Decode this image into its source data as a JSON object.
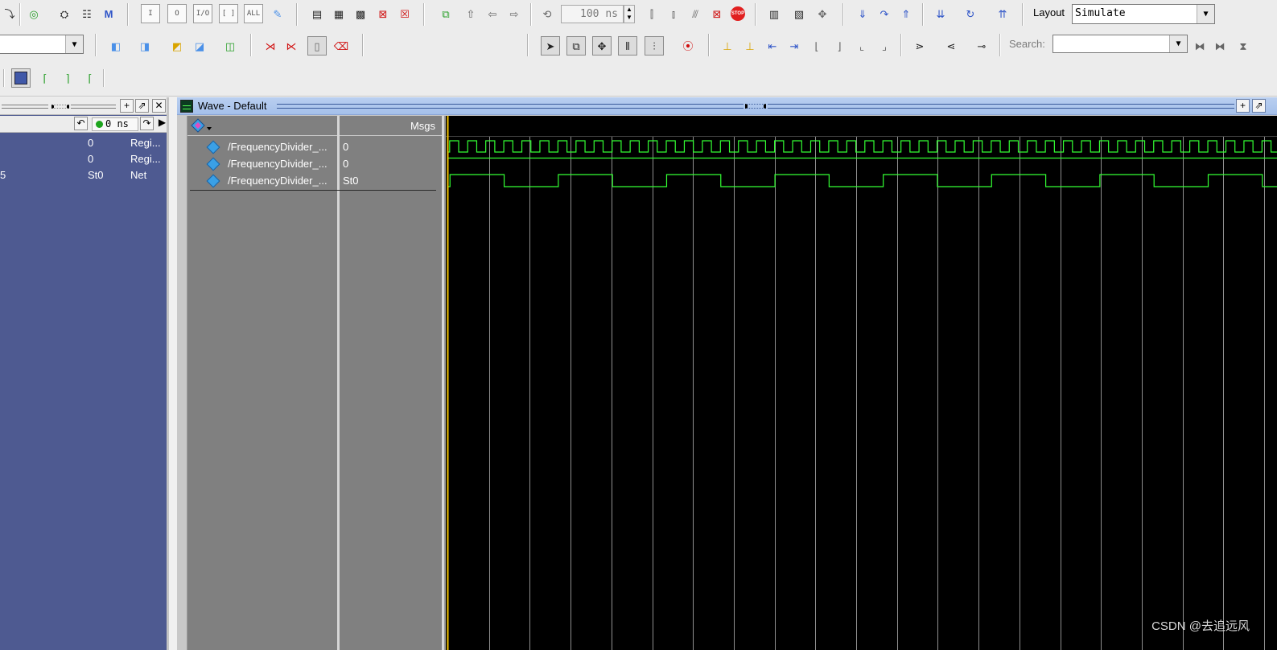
{
  "toolbar": {
    "row1_icons": [
      "step-icon",
      "sim-icon",
      "find-icon",
      "hierarchy-icon",
      "modelsim-icon"
    ],
    "radix_buttons": [
      "I",
      "O",
      "I/O",
      "[ ]",
      "ALL"
    ],
    "run_length": "100 ns",
    "layout_label": "Layout",
    "layout_value": "Simulate"
  },
  "search": {
    "label": "Search:",
    "value": ""
  },
  "objects": {
    "now_time": "0 ns",
    "rows": [
      {
        "value": "0",
        "kind": "Regi..."
      },
      {
        "value": "0",
        "kind": "Regi..."
      },
      {
        "prefix": "5",
        "value": "St0",
        "kind": "Net"
      }
    ]
  },
  "wave": {
    "title": "Wave - Default",
    "msgs_label": "Msgs",
    "signals": [
      {
        "name": "/FrequencyDivider_...",
        "value": "0"
      },
      {
        "name": "/FrequencyDivider_...",
        "value": "0"
      },
      {
        "name": "/FrequencyDivider_...",
        "value": "St0"
      }
    ],
    "colors": {
      "wave": "#33ff33",
      "cursor": "#f2c200",
      "grid": "#8f8f8f"
    },
    "clk_cycles": 46,
    "div_cycles": 3
  },
  "watermark": "CSDN @去追远风"
}
